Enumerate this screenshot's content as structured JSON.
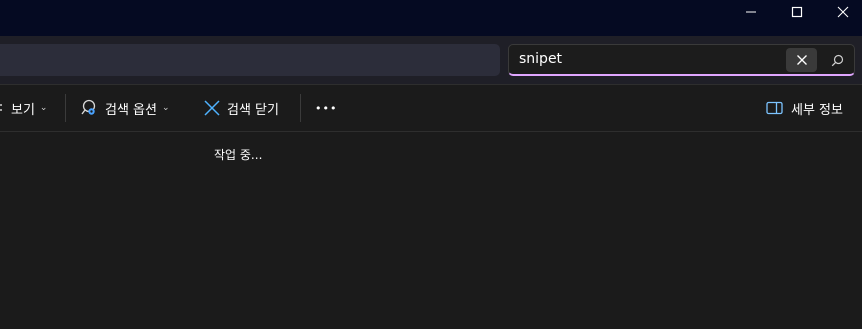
{
  "window": {
    "minimize_icon": "minimize-icon",
    "maximize_icon": "maximize-icon",
    "close_icon": "close-icon"
  },
  "search": {
    "value": "snipet"
  },
  "toolbar": {
    "view_partial_label": "보기",
    "search_options_label": "검색 옵션",
    "close_search_label": "검색 닫기",
    "more_label": "•••",
    "details_label": "세부 정보"
  },
  "content": {
    "status": "작업 중..."
  },
  "colors": {
    "titlebar": "#050a22",
    "accent_underline": "#e0a6ff",
    "search_options_icon": "#4aa3ff",
    "close_search_icon": "#4fb3ff",
    "details_icon": "#7cc4ff"
  }
}
